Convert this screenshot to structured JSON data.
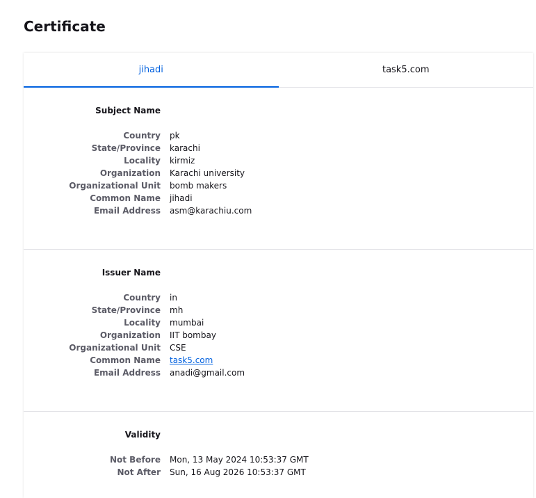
{
  "page": {
    "title": "Certificate"
  },
  "tabs": [
    {
      "label": "jihadi",
      "active": true
    },
    {
      "label": "task5.com",
      "active": false
    }
  ],
  "subject": {
    "title": "Subject Name",
    "fields": [
      {
        "label": "Country",
        "value": "pk"
      },
      {
        "label": "State/Province",
        "value": "karachi"
      },
      {
        "label": "Locality",
        "value": "kirmiz"
      },
      {
        "label": "Organization",
        "value": "Karachi university"
      },
      {
        "label": "Organizational Unit",
        "value": "bomb makers"
      },
      {
        "label": "Common Name",
        "value": "jihadi"
      },
      {
        "label": "Email Address",
        "value": "asm@karachiu.com"
      }
    ]
  },
  "issuer": {
    "title": "Issuer Name",
    "fields": [
      {
        "label": "Country",
        "value": "in"
      },
      {
        "label": "State/Province",
        "value": "mh"
      },
      {
        "label": "Locality",
        "value": "mumbai"
      },
      {
        "label": "Organization",
        "value": "IIT bombay"
      },
      {
        "label": "Organizational Unit",
        "value": "CSE"
      },
      {
        "label": "Common Name",
        "value": "task5.com"
      },
      {
        "label": "Email Address",
        "value": "anadi@gmail.com"
      }
    ]
  },
  "validity": {
    "title": "Validity",
    "fields": [
      {
        "label": "Not Before",
        "value": "Mon, 13 May 2024 10:53:37 GMT"
      },
      {
        "label": "Not After",
        "value": "Sun, 16 Aug 2026 10:53:37 GMT"
      }
    ]
  },
  "colors": {
    "accent": "#0060df",
    "label": "#5b5b66",
    "text": "#15141a",
    "divider": "#e2e2e6"
  }
}
